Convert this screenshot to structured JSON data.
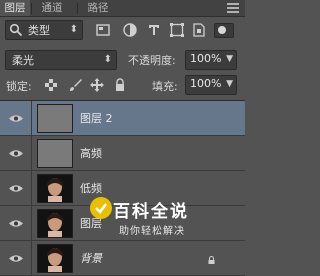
{
  "tabs": [
    {
      "label": "图层",
      "active": true
    },
    {
      "label": "通道",
      "active": false
    },
    {
      "label": "路径",
      "active": false
    }
  ],
  "filter": {
    "kind_label": "类型",
    "icons": [
      "pixel-filter-icon",
      "adjustment-filter-icon",
      "type-filter-icon",
      "shape-filter-icon",
      "smart-object-filter-icon"
    ]
  },
  "blend": {
    "mode": "柔光",
    "opacity_label": "不透明度:",
    "opacity_value": "100%"
  },
  "lock": {
    "label": "锁定:",
    "fill_label": "填充:",
    "fill_value": "100%"
  },
  "layers": [
    {
      "name": "图层 2",
      "selected": true,
      "thumb": "grey"
    },
    {
      "name": "高频",
      "selected": false,
      "thumb": "grey"
    },
    {
      "name": "低频",
      "selected": false,
      "thumb": "photo"
    },
    {
      "name": "图层",
      "selected": false,
      "thumb": "photo"
    },
    {
      "name": "背景",
      "selected": false,
      "thumb": "photo",
      "italic": true,
      "locked": true
    }
  ],
  "watermark": {
    "brand": "百科全说",
    "sub": "助你轻松解决",
    "color": "#e8c000"
  },
  "colors": {
    "panel": "#535353",
    "selected_row": "#66778c",
    "tab_bar": "#424242"
  }
}
